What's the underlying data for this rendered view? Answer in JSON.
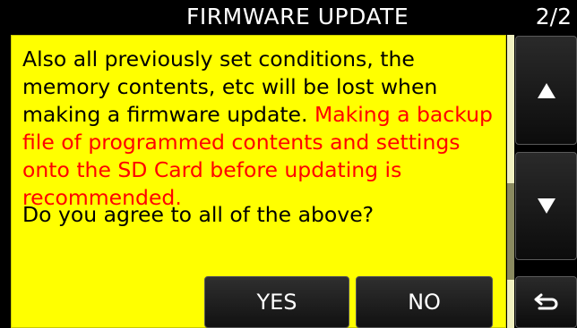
{
  "header": {
    "title": "FIRMWARE UPDATE",
    "page_indicator": "2/2"
  },
  "message": {
    "normal_text": "Also all previously set conditions, the memory contents, etc will be lost when making a firmware update.",
    "warning_text": "Making a backup file of programmed contents and settings onto the SD Card before updating is recommended.",
    "question": "Do you agree to all of the above?"
  },
  "buttons": {
    "yes_label": "YES",
    "no_label": "NO"
  },
  "side_buttons": {
    "up_icon": "triangle-up-icon",
    "down_icon": "triangle-down-icon",
    "back_icon": "return-arrow-icon"
  },
  "colors": {
    "message_background": "#ffff00",
    "warning_text": "#ff0000",
    "screen_background": "#000000"
  }
}
